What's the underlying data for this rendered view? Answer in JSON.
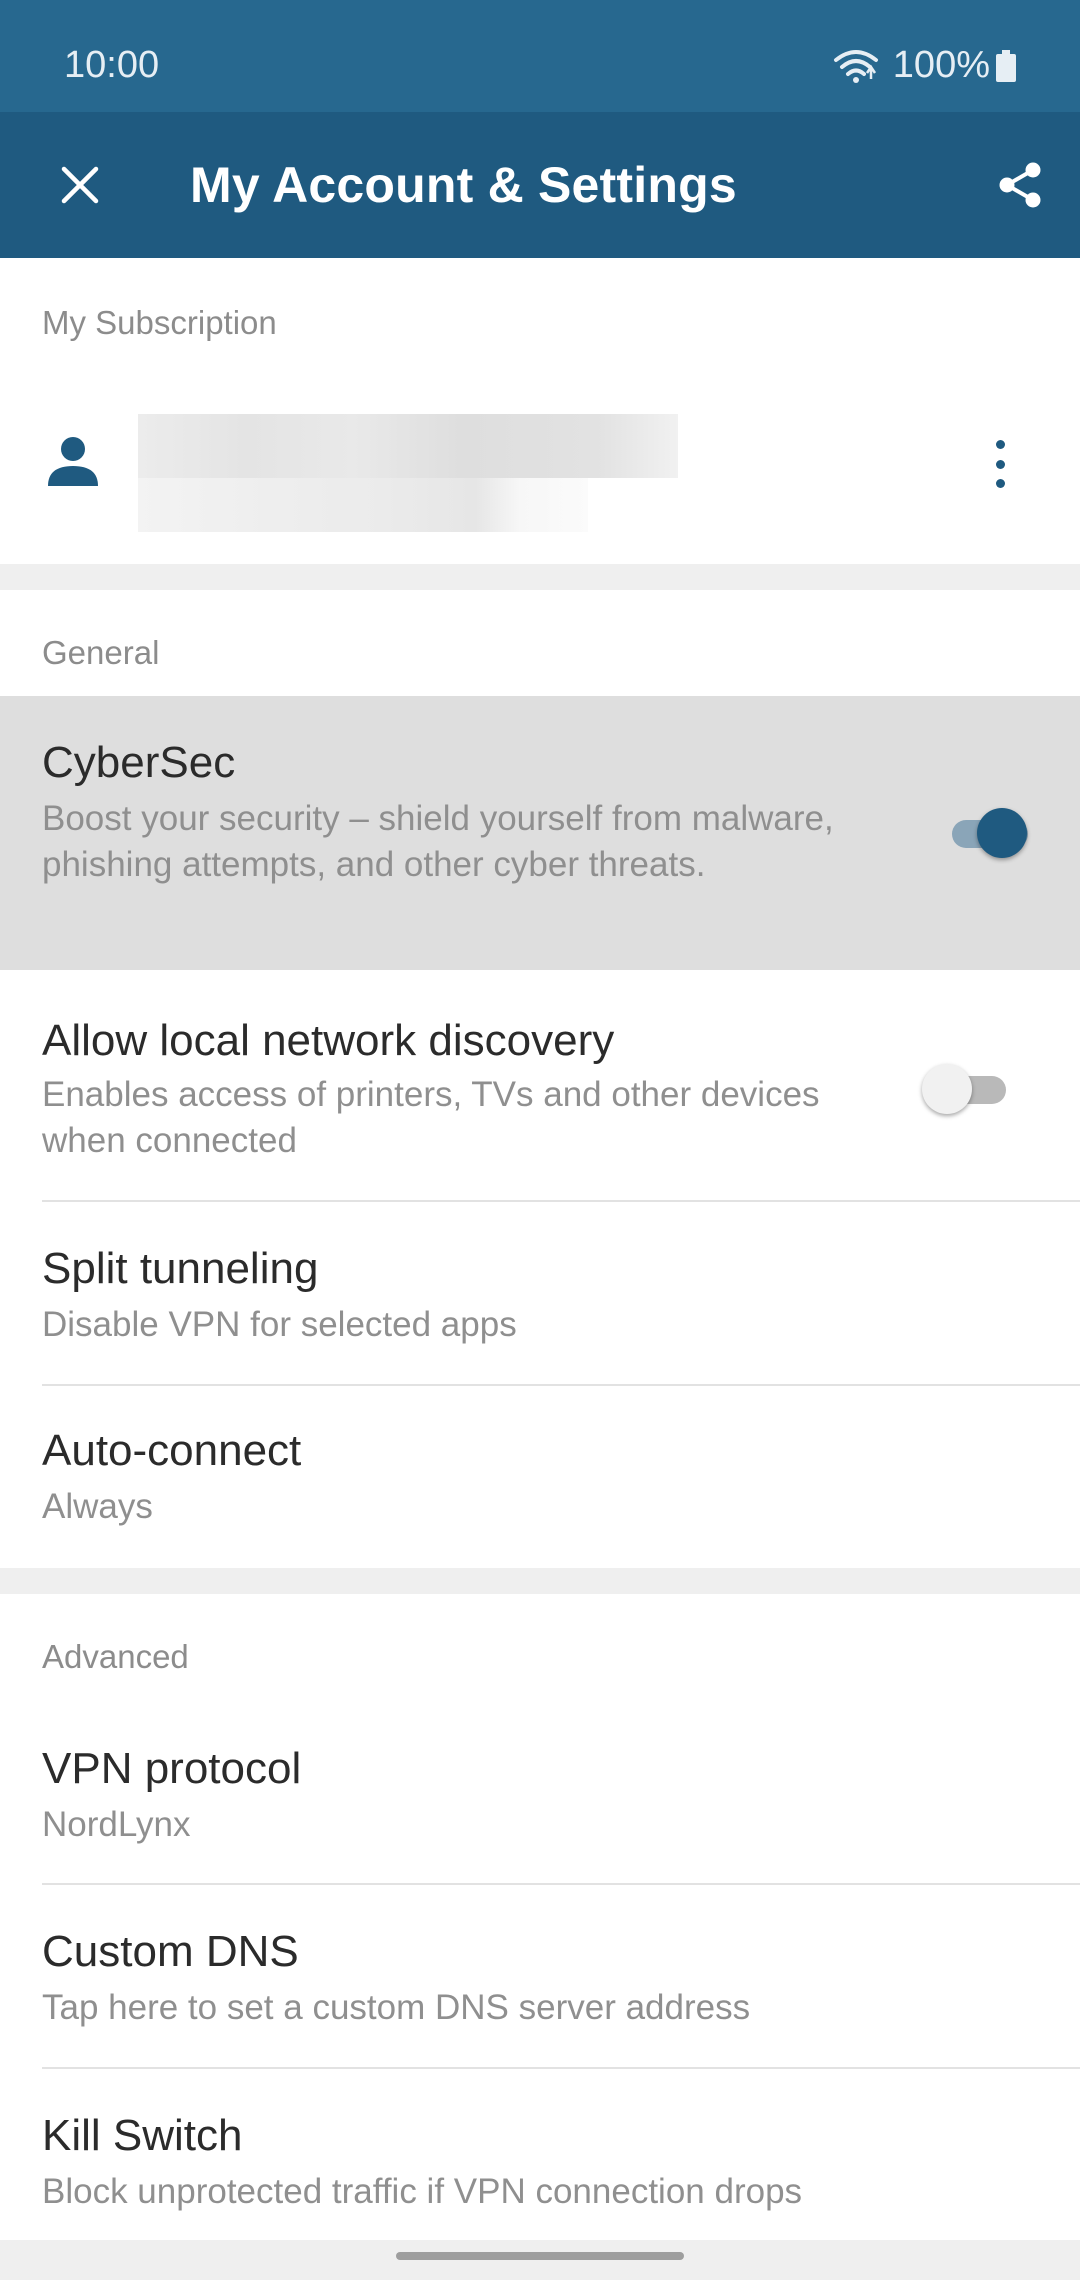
{
  "status_bar": {
    "time": "10:00",
    "battery": "100%"
  },
  "header": {
    "title": "My Account & Settings",
    "close_icon": "close-icon",
    "share_icon": "share-icon"
  },
  "subscription": {
    "label": "My Subscription",
    "avatar_icon": "person-icon",
    "more_icon": "more-vert-icon"
  },
  "general": {
    "label": "General",
    "items": [
      {
        "title": "CyberSec",
        "subtitle": "Boost your security – shield yourself from malware, phishing attempts, and other cyber threats.",
        "toggle": true
      },
      {
        "title": "Allow local network discovery",
        "subtitle": "Enables access of printers, TVs and other devices when connected",
        "toggle": false
      },
      {
        "title": "Split tunneling",
        "subtitle": "Disable VPN for selected apps"
      },
      {
        "title": "Auto-connect",
        "subtitle": "Always"
      }
    ]
  },
  "advanced": {
    "label": "Advanced",
    "items": [
      {
        "title": "VPN protocol",
        "subtitle": "NordLynx"
      },
      {
        "title": "Custom DNS",
        "subtitle": "Tap here to set a custom DNS server address"
      },
      {
        "title": "Kill Switch",
        "subtitle": "Block unprotected traffic if VPN connection drops"
      }
    ]
  },
  "colors": {
    "status_bar": "#27688f",
    "app_bar": "#1f5a80",
    "accent": "#1f5a80",
    "highlight_row": "#dedede"
  }
}
